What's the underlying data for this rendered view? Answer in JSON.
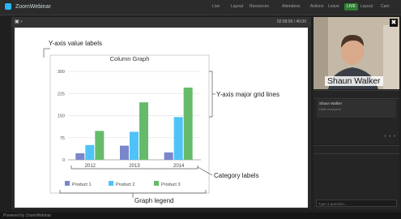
{
  "app": {
    "brand": "ZoomWebinar"
  },
  "topbar": {
    "items": [
      "Live",
      "Layout",
      "Resources",
      "Attendees",
      "Actions",
      "Leave",
      "Layout",
      "Cam"
    ],
    "live_button": "LIVE"
  },
  "content": {
    "toolbar_right": "02:08:09 / 40:00"
  },
  "chart_data": {
    "type": "bar",
    "title": "Column Graph",
    "categories": [
      "2012",
      "2013",
      "2014"
    ],
    "series": [
      {
        "name": "Product 1",
        "values": [
          22,
          48,
          25
        ]
      },
      {
        "name": "Product 2",
        "values": [
          50,
          95,
          145
        ]
      },
      {
        "name": "Product 3",
        "values": [
          98,
          195,
          245
        ]
      }
    ],
    "y_ticks": [
      "300",
      "225",
      "150",
      "75",
      "0"
    ],
    "ylim": [
      0,
      300
    ],
    "grid": true,
    "legend": "bottom",
    "colors": {
      "Product 1": "#7986cb",
      "Product 2": "#4fc3f7",
      "Product 3": "#66bb6a"
    },
    "annotations": {
      "yaxis_value_labels": "Y-axis value labels",
      "yaxis_grid": "Y-axis major grid lines",
      "category_labels": "Category labels",
      "graph_legend": "Graph legend"
    }
  },
  "webcam": {
    "name": "Shaun Walker"
  },
  "chat": {
    "message_author": "Shaun Walker",
    "message_text": "Hello everyone"
  },
  "qa": {
    "placeholder": "Type a question..."
  },
  "bottombar": {
    "text": "Powered by ZoomWebinar"
  }
}
